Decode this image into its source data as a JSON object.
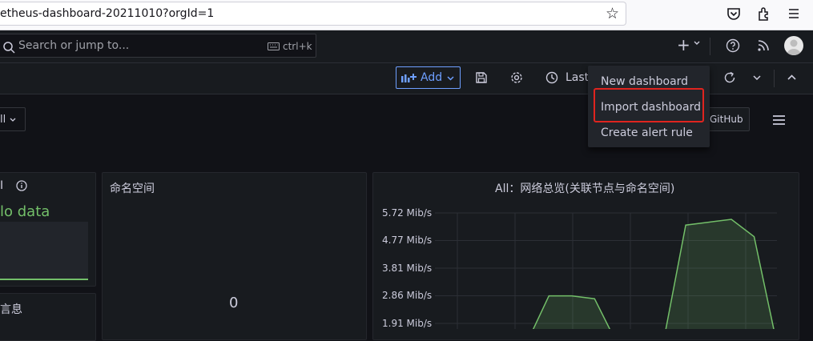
{
  "browser": {
    "url": "etheus-dashboard-20211010?orgId=1",
    "icons": [
      "bookmark-star-icon",
      "pocket-icon",
      "extensions-icon",
      "menu-icon"
    ]
  },
  "topnav": {
    "search_placeholder": "Search or jump to...",
    "shortcut": "ctrl+k",
    "icons": [
      "plus-icon",
      "help-icon",
      "rss-icon",
      "avatar"
    ]
  },
  "toolbar": {
    "add_label": "Add",
    "time_label": "Last",
    "icons": [
      "save-icon",
      "settings-icon",
      "clock-icon",
      "refresh-icon",
      "collapse-icon"
    ]
  },
  "variables": {
    "selected": "ll"
  },
  "links": {
    "github": "GitHub"
  },
  "add_menu": {
    "items": [
      "New dashboard",
      "Import dashboard",
      "Create alert rule"
    ],
    "highlight_color": "#e0241f"
  },
  "panels": {
    "left_title": "I",
    "left_value": "lo data",
    "left_bottom_title": "言息",
    "namespace_title": "命名空间",
    "namespace_value": "0",
    "network_title": "All：网络总览(关联节点与命名空间)",
    "network_yticks": [
      "5.72 Mib/s",
      "4.77 Mib/s",
      "3.81 Mib/s",
      "2.86 Mib/s",
      "1.91 Mib/s"
    ]
  },
  "chart_data": {
    "type": "area",
    "title": "All：网络总览(关联节点与命名空间)",
    "xlabel": "",
    "ylabel": "",
    "yticks": [
      "5.72 Mib/s",
      "4.77 Mib/s",
      "3.81 Mib/s",
      "2.86 Mib/s",
      "1.91 Mib/s"
    ],
    "ylim": [
      1.91,
      5.72
    ],
    "unit": "Mib/s",
    "series": [
      {
        "color": "#73bf69",
        "x": [
          0,
          1,
          2,
          3,
          4,
          5,
          6,
          7,
          8,
          9,
          10,
          11,
          12,
          13,
          14,
          15
        ],
        "values": [
          0,
          0,
          0,
          0,
          0,
          2.86,
          2.86,
          2.76,
          0,
          0,
          0,
          5.3,
          5.4,
          5.5,
          4.9,
          0
        ]
      }
    ],
    "colors": {
      "accent": "#6e9fff",
      "series": "#73bf69",
      "background": "#181b1f"
    }
  }
}
